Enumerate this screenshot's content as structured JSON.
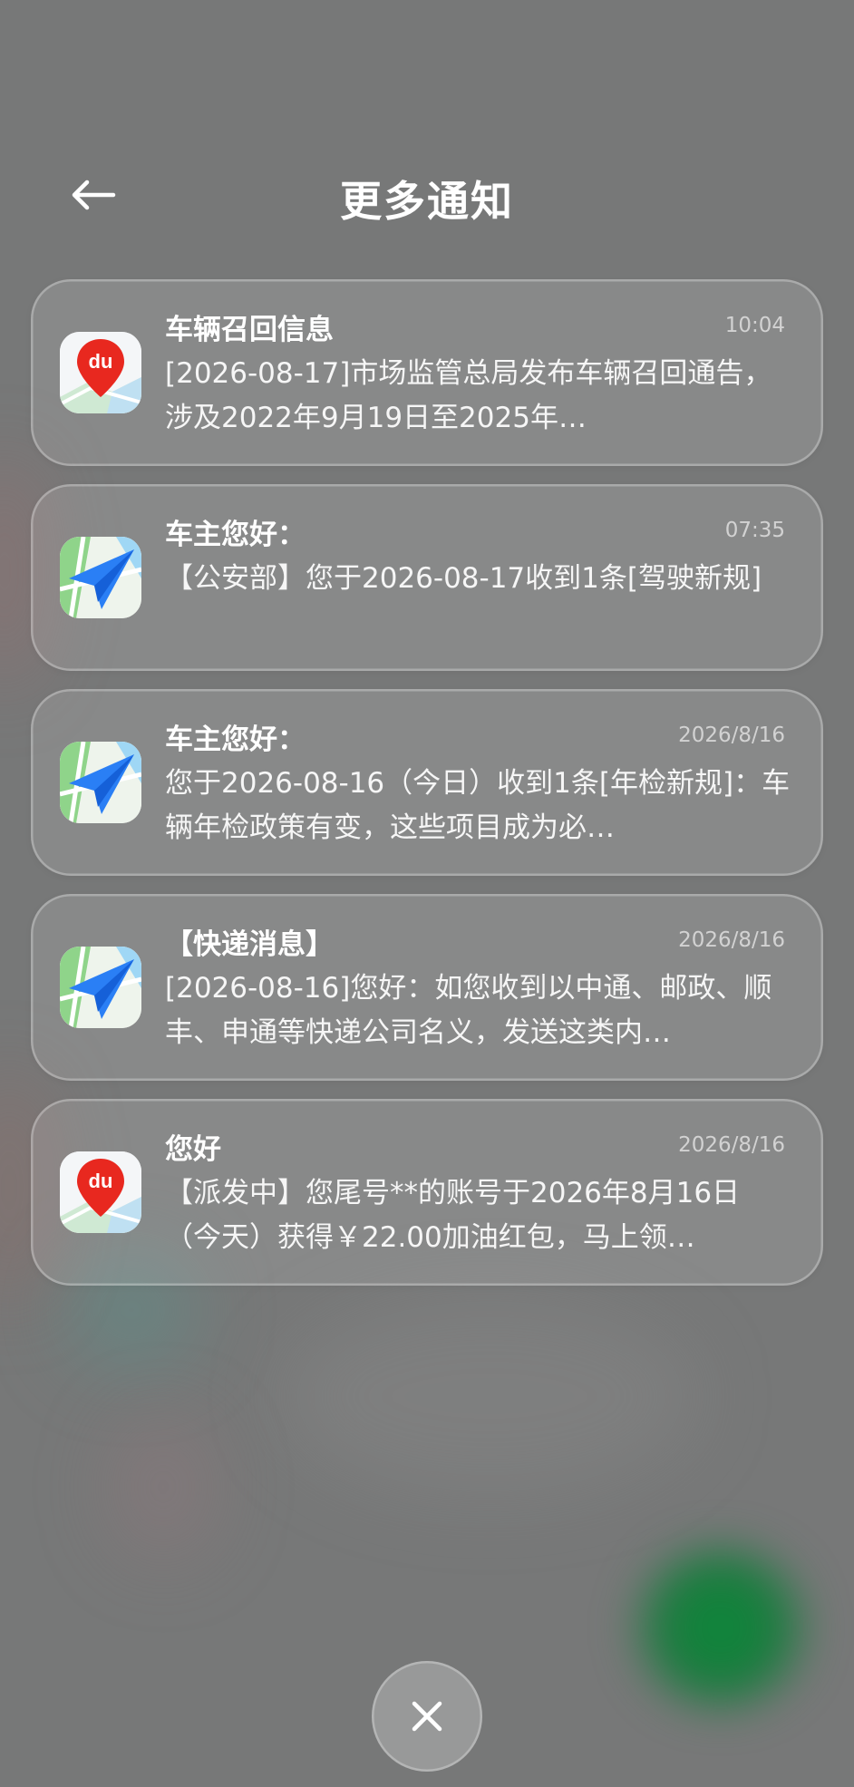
{
  "header": {
    "title": "更多通知",
    "back_icon": "arrow-left-icon"
  },
  "notifications": [
    {
      "app_icon": "baidu-map-icon",
      "title": "车辆召回信息",
      "time": "10:04",
      "body": "[2026-08-17]市场监管总局发布车辆召回通告，涉及2022年9月19日至2025年…"
    },
    {
      "app_icon": "paper-plane-map-icon",
      "title": "车主您好：",
      "time": "07:35",
      "body": "【公安部】您于2026-08-17收到1条[驾驶新规]"
    },
    {
      "app_icon": "paper-plane-map-icon",
      "title": "车主您好：",
      "time": "2026/8/16",
      "body": "您于2026-08-16（今日）收到1条[年检新规]：车辆年检政策有变，这些项目成为必…"
    },
    {
      "app_icon": "paper-plane-map-icon",
      "title": "【快递消息】",
      "time": "2026/8/16",
      "body": "[2026-08-16]您好：如您收到以中通、邮政、顺丰、申通等快递公司名义，发送这类内…"
    },
    {
      "app_icon": "baidu-map-icon",
      "title": "您好",
      "time": "2026/8/16",
      "body": "【派发中】您尾号**的账号于2026年8月16日（今天）获得￥22.00加油红包，马上领…"
    }
  ],
  "close_icon": "close-icon",
  "colors": {
    "baidu_red": "#e8281f",
    "amap_blue": "#2a7ff5",
    "map_green": "#8fd48a",
    "background": "#777878"
  }
}
